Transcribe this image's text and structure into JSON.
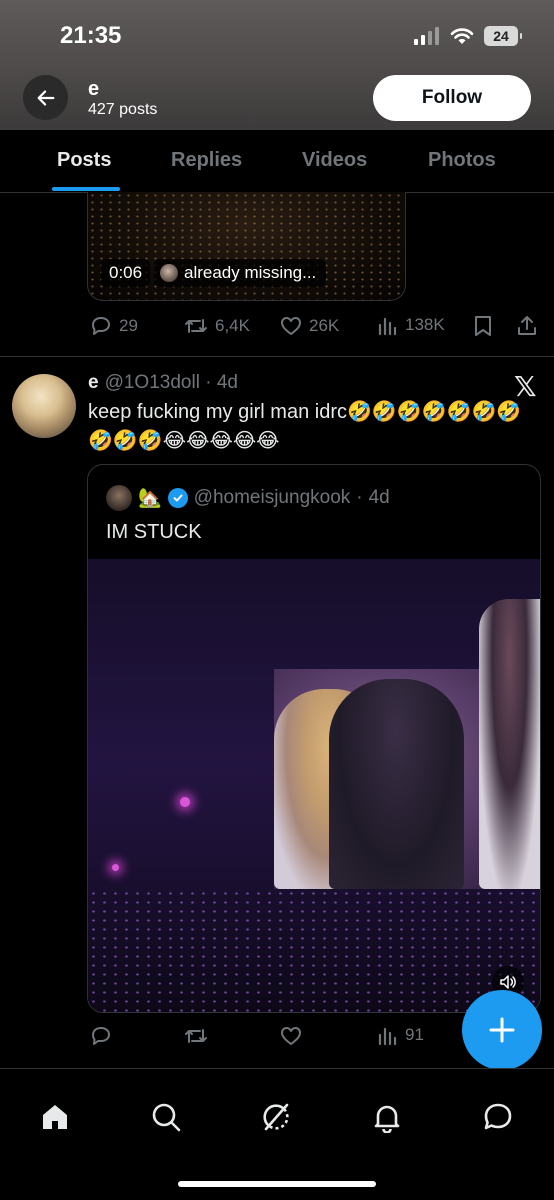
{
  "status_bar": {
    "time": "21:35",
    "battery": "24"
  },
  "header": {
    "name": "e",
    "post_count": "427 posts",
    "follow_label": "Follow"
  },
  "tabs": [
    {
      "label": "Posts",
      "active": true
    },
    {
      "label": "Replies",
      "active": false
    },
    {
      "label": "Videos",
      "active": false
    },
    {
      "label": "Photos",
      "active": false
    }
  ],
  "tweet1": {
    "video_time": "0:06",
    "video_caption": "already missing...",
    "replies": "29",
    "reposts": "6,4K",
    "likes": "26K",
    "views": "138K"
  },
  "tweet2": {
    "author_name": "e",
    "handle": "@1O13doll",
    "time": "4d",
    "text": "keep fucking my girl man idrc🤣🤣🤣🤣🤣🤣🤣🤣🤣🤣😂😂😂😂😂",
    "quote": {
      "handle": "@homeisjungkook",
      "time": "4d",
      "emojis": "🏡",
      "text": "IM STUCK"
    },
    "views": "91"
  },
  "icons": {
    "back": "back-arrow-icon",
    "reply": "reply-icon",
    "repost": "repost-icon",
    "like": "heart-icon",
    "views": "views-icon",
    "bookmark": "bookmark-icon",
    "share": "share-icon",
    "compose": "plus-icon",
    "home": "home-icon",
    "search": "search-icon",
    "grok": "grok-icon",
    "notifications": "bell-icon",
    "messages": "message-icon"
  },
  "colors": {
    "accent": "#1d9bf0",
    "muted": "#71767b",
    "text": "#e7e9ea",
    "background": "#000000"
  }
}
